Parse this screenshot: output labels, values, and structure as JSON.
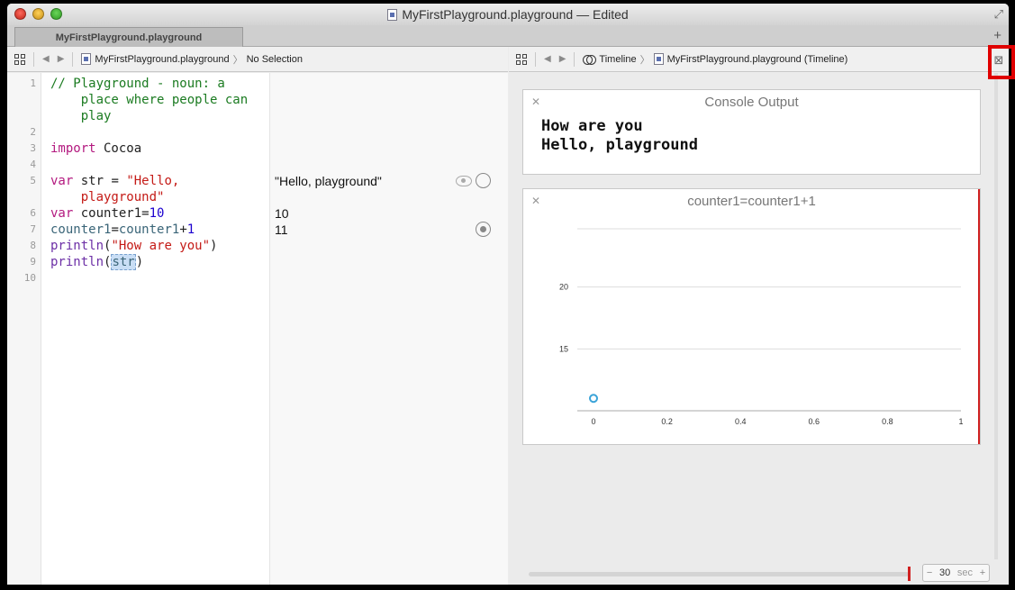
{
  "window": {
    "title": "MyFirstPlayground.playground — Edited",
    "tab_label": "MyFirstPlayground.playground"
  },
  "left_nav": {
    "file": "MyFirstPlayground.playground",
    "selection": "No Selection"
  },
  "right_nav": {
    "mode": "Timeline",
    "file": "MyFirstPlayground.playground (Timeline)"
  },
  "editor": {
    "line_numbers": [
      "1",
      "2",
      "3",
      "4",
      "5",
      "6",
      "7",
      "8",
      "9",
      "10"
    ],
    "results": {
      "line5": "\"Hello, playground\"",
      "line6": "10",
      "line7": "11"
    }
  },
  "console": {
    "title": "Console Output",
    "text": "How are you\nHello, playground"
  },
  "chart_card": {
    "title": "counter1=counter1+1"
  },
  "chart_data": {
    "type": "scatter",
    "title": "counter1=counter1+1",
    "x": [
      0
    ],
    "y": [
      11
    ],
    "xlim": [
      0,
      1
    ],
    "ylim": [
      10,
      25
    ],
    "x_ticks": [
      "0",
      "0.2",
      "0.4",
      "0.6",
      "0.8",
      "1"
    ],
    "y_ticks": [
      "15",
      "20"
    ],
    "grid": true,
    "series_color": "#3aa3d8"
  },
  "timeline": {
    "duration": "30",
    "unit": "sec",
    "decrement": "−",
    "increment": "+"
  },
  "colors": {
    "comment": "#1b7b21",
    "keyword": "#b3197f",
    "string": "#c41a16",
    "number": "#1c00cf",
    "highlight": "#e00000"
  }
}
